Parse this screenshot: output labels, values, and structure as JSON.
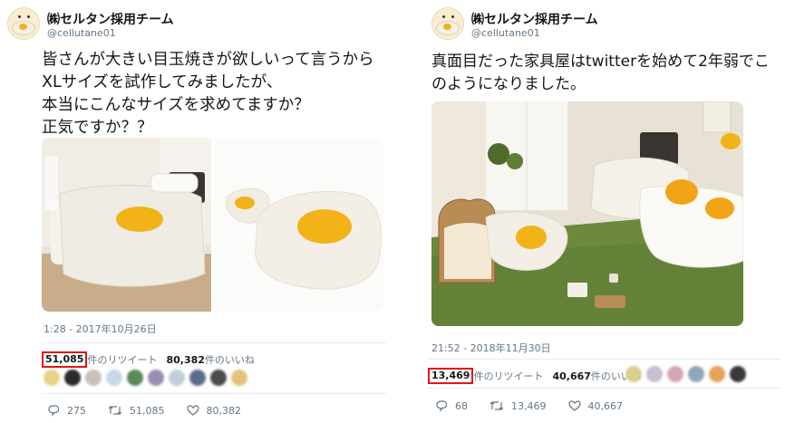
{
  "tweets": [
    {
      "account_name": "㈱セルタン採用チーム",
      "handle": "@cellutane01",
      "text": "皆さんが大きい目玉焼きが欲しいって言うからXLサイズを試作してみましたが、\n本当にこんなサイズを求めてますか？\n正気ですか？？",
      "timestamp": "1:28 - 2017年10月26日",
      "retweets": "51,085",
      "retweets_label": "件のリツイート",
      "likes": "80,382",
      "likes_label": "件のいいね",
      "actions": {
        "replies": "275",
        "retweets": "51,085",
        "likes": "80,382"
      }
    },
    {
      "account_name": "㈱セルタン採用チーム",
      "handle": "@cellutane01",
      "text": "真面目だった家具屋はtwitterを始めて2年弱でこのようになりました。",
      "timestamp": "21:52 - 2018年11月30日",
      "retweets": "13,469",
      "retweets_label": "件のリツイート",
      "likes": "40,667",
      "likes_label": "件のいいね",
      "actions": {
        "replies": "68",
        "retweets": "13,469",
        "likes": "40,667"
      }
    }
  ],
  "colors": {
    "highlight": "#e0161b",
    "muted": "#657786",
    "yolk": "#f2b319"
  },
  "icons": [
    "reply-icon",
    "retweet-icon",
    "like-icon"
  ]
}
